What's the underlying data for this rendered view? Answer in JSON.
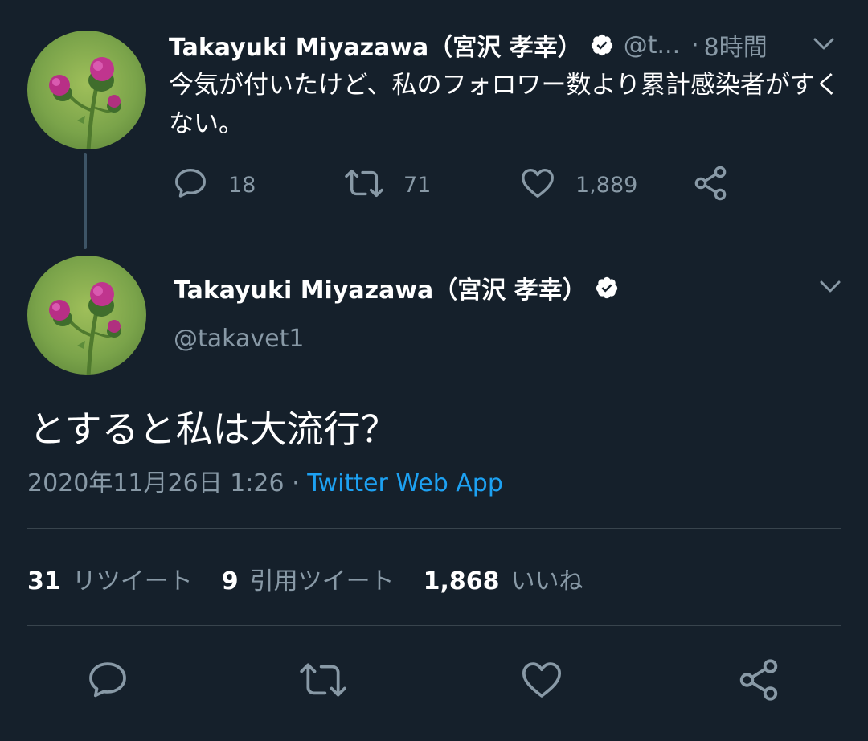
{
  "colors": {
    "background": "#15202b",
    "text": "#ffffff",
    "muted": "#8899a6",
    "link": "#1da1f2",
    "divider": "#38444d"
  },
  "reply_tweet": {
    "avatar_icon": "thistle-flower-avatar",
    "author_name": "Takayuki Miyazawa（宮沢 孝幸）",
    "verified_icon": "verified-badge-icon",
    "handle_truncated": "@t...",
    "separator": "·",
    "time_ago": "8時間",
    "text": "今気が付いたけど、私のフォロワー数より累計感染者がすくない。",
    "actions": {
      "reply_count": "18",
      "retweet_count": "71",
      "like_count": "1,889"
    }
  },
  "main_tweet": {
    "avatar_icon": "thistle-flower-avatar",
    "author_name": "Takayuki Miyazawa（宮沢 孝幸）",
    "verified_icon": "verified-badge-icon",
    "handle": "@takavet1",
    "text": "とすると私は大流行？",
    "timestamp": "2020年11月26日 1:26",
    "separator": "·",
    "source": "Twitter Web App",
    "stats": {
      "retweets_count": "31",
      "retweets_label": "リツイート",
      "quotes_count": "9",
      "quotes_label": "引用ツイート",
      "likes_count": "1,868",
      "likes_label": "いいね"
    }
  }
}
